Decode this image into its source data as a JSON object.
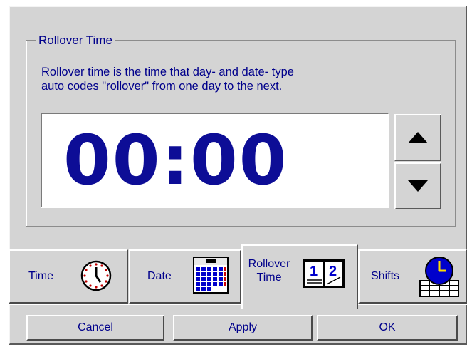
{
  "rollover": {
    "group_title": "Rollover Time",
    "description": "Rollover time is the time that day- and date- type\nauto codes \"rollover\" from one day to the next.",
    "time_value": "00:00",
    "spin_up_icon": "triangle-up-icon",
    "spin_down_icon": "triangle-down-icon"
  },
  "tabs": [
    {
      "label": "Time",
      "icon": "clock-icon",
      "selected": false
    },
    {
      "label": "Date",
      "icon": "calendar-icon",
      "selected": false
    },
    {
      "label": "Rollover\nTime",
      "icon": "rollover-days-icon",
      "selected": true
    },
    {
      "label": "Shifts",
      "icon": "shift-clock-icon",
      "selected": false
    }
  ],
  "buttons": {
    "cancel": "Cancel",
    "apply": "Apply",
    "ok": "OK"
  },
  "colors": {
    "text": "#00008b",
    "time_digits": "#0d0d96",
    "face": "#d4d4d4"
  }
}
